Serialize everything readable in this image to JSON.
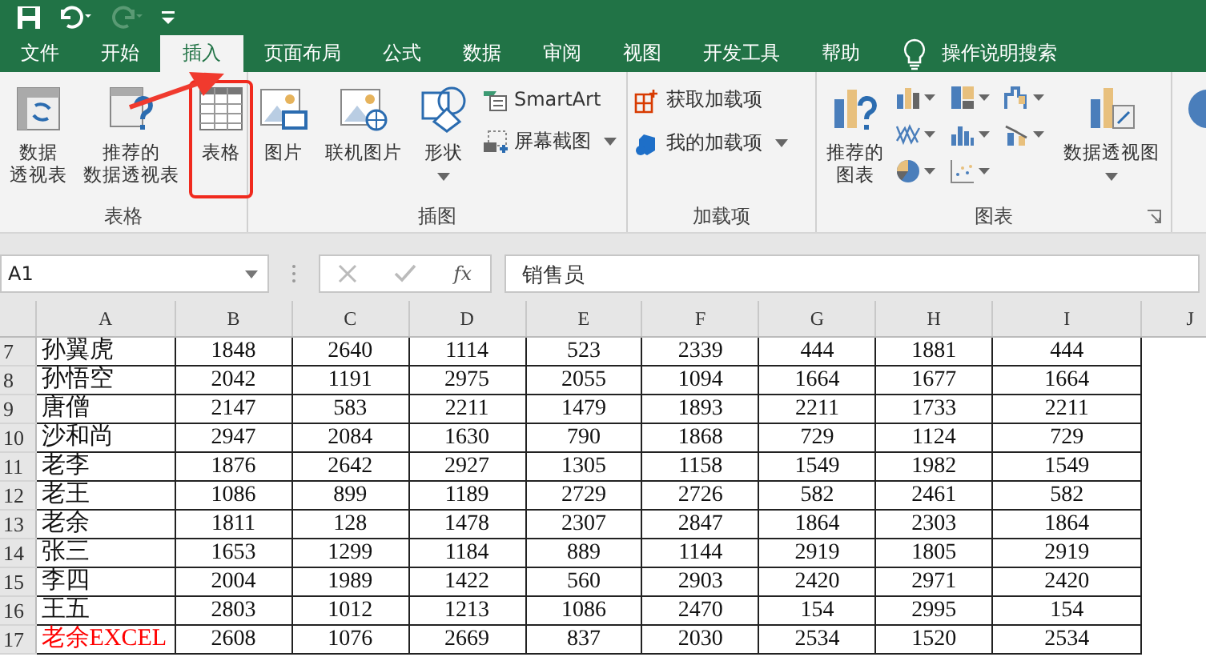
{
  "tabs": [
    {
      "label": "文件",
      "selected": false
    },
    {
      "label": "开始",
      "selected": false
    },
    {
      "label": "插入",
      "selected": true
    },
    {
      "label": "页面布局",
      "selected": false
    },
    {
      "label": "公式",
      "selected": false
    },
    {
      "label": "数据",
      "selected": false
    },
    {
      "label": "审阅",
      "selected": false
    },
    {
      "label": "视图",
      "selected": false
    },
    {
      "label": "开发工具",
      "selected": false
    },
    {
      "label": "帮助",
      "selected": false
    }
  ],
  "tell_me": "操作说明搜索",
  "ribbon": {
    "groups": [
      {
        "label": "表格",
        "items": [
          {
            "kind": "pivot",
            "lines": [
              "数据",
              "透视表"
            ]
          },
          {
            "kind": "recommended-pivot",
            "lines": [
              "推荐的",
              "数据透视表"
            ]
          },
          {
            "kind": "table",
            "lines": [
              "表格"
            ],
            "highlighted": true
          }
        ]
      },
      {
        "label": "插图",
        "items": [
          {
            "kind": "picture",
            "lines": [
              "图片"
            ]
          },
          {
            "kind": "online-picture",
            "lines": [
              "联机图片"
            ]
          },
          {
            "kind": "shapes",
            "lines": [
              "形状"
            ],
            "dropdown": true
          },
          {
            "kind": "stack",
            "entries": [
              {
                "kind": "smartart",
                "label": "SmartArt"
              },
              {
                "kind": "screenshot",
                "label": "屏幕截图",
                "dropdown": true
              }
            ]
          }
        ]
      },
      {
        "label": "加载项",
        "items": [
          {
            "kind": "stack",
            "entries": [
              {
                "kind": "get-addins",
                "label": "获取加载项"
              },
              {
                "kind": "my-addins",
                "label": "我的加载项",
                "dropdown": true
              }
            ]
          }
        ]
      },
      {
        "label": "图表",
        "launcher": true,
        "items": [
          {
            "kind": "recommended-chart",
            "lines": [
              "推荐的",
              "图表"
            ]
          },
          {
            "kind": "gallery",
            "charts": [
              {
                "kind": "column",
                "dropdown": true
              },
              {
                "kind": "hierarchy",
                "dropdown": true
              },
              {
                "kind": "waterfall",
                "dropdown": true
              },
              {
                "kind": "line",
                "dropdown": true
              },
              {
                "kind": "histogram",
                "dropdown": true
              },
              {
                "kind": "combo",
                "dropdown": true
              },
              {
                "kind": "pie",
                "dropdown": true
              },
              {
                "kind": "scatter",
                "dropdown": true
              }
            ]
          },
          {
            "kind": "pivot-chart",
            "lines": [
              "数据透视图"
            ],
            "dropdown": true
          }
        ]
      },
      {
        "items": [
          {
            "kind": "map"
          }
        ]
      }
    ]
  },
  "name_box": "A1",
  "function_label": "fx",
  "formula": "销售员",
  "columns": [
    "A",
    "B",
    "C",
    "D",
    "E",
    "F",
    "G",
    "H",
    "I",
    "J"
  ],
  "rows": [
    {
      "number": "7",
      "name": "孙翼虎",
      "values": [
        "1848",
        "2640",
        "1114",
        "523",
        "2339",
        "444",
        "1881",
        "444"
      ]
    },
    {
      "number": "8",
      "name": "孙悟空",
      "values": [
        "2042",
        "1191",
        "2975",
        "2055",
        "1094",
        "1664",
        "1677",
        "1664"
      ]
    },
    {
      "number": "9",
      "name": "唐僧",
      "values": [
        "2147",
        "583",
        "2211",
        "1479",
        "1893",
        "2211",
        "1733",
        "2211"
      ]
    },
    {
      "number": "10",
      "name": "沙和尚",
      "values": [
        "2947",
        "2084",
        "1630",
        "790",
        "1868",
        "729",
        "1124",
        "729"
      ]
    },
    {
      "number": "11",
      "name": "老李",
      "values": [
        "1876",
        "2642",
        "2927",
        "1305",
        "1158",
        "1549",
        "1982",
        "1549"
      ]
    },
    {
      "number": "12",
      "name": "老王",
      "values": [
        "1086",
        "899",
        "1189",
        "2729",
        "2726",
        "582",
        "2461",
        "582"
      ]
    },
    {
      "number": "13",
      "name": "老余",
      "values": [
        "1811",
        "128",
        "1478",
        "2307",
        "2847",
        "1864",
        "2303",
        "1864"
      ]
    },
    {
      "number": "14",
      "name": "张三",
      "values": [
        "1653",
        "1299",
        "1184",
        "889",
        "1144",
        "2919",
        "1805",
        "2919"
      ]
    },
    {
      "number": "15",
      "name": "李四",
      "values": [
        "2004",
        "1989",
        "1422",
        "560",
        "2903",
        "2420",
        "2971",
        "2420"
      ]
    },
    {
      "number": "16",
      "name": "王五",
      "values": [
        "2803",
        "1012",
        "1213",
        "1086",
        "2470",
        "154",
        "2995",
        "154"
      ]
    },
    {
      "number": "17",
      "name": "老余EXCEL",
      "color": "#ff0000",
      "values": [
        "2608",
        "1076",
        "2669",
        "837",
        "2030",
        "2534",
        "1520",
        "2534"
      ]
    }
  ]
}
